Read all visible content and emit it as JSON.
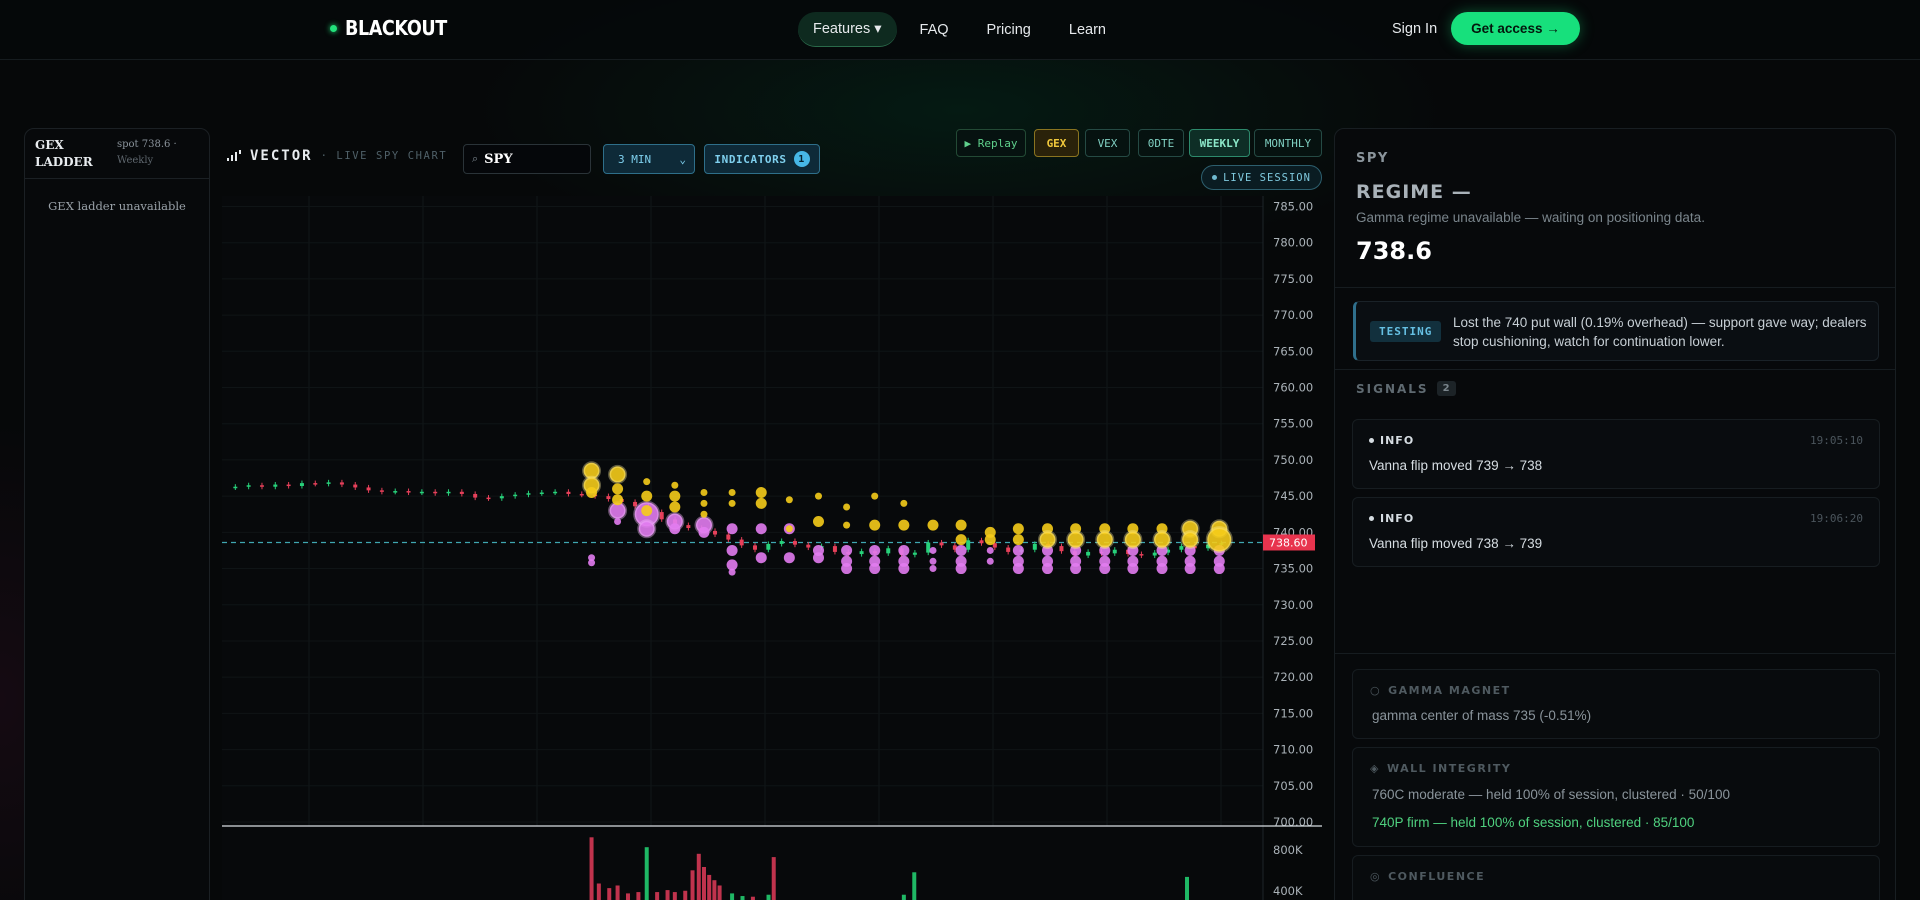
{
  "nav": {
    "brand": "BLACKOUT",
    "links": [
      {
        "label": "Features ▾",
        "active": true
      },
      {
        "label": "FAQ",
        "active": false
      },
      {
        "label": "Pricing",
        "active": false
      },
      {
        "label": "Learn",
        "active": false
      }
    ],
    "signin": "Sign In",
    "cta": "Get access →"
  },
  "gex_ladder": {
    "title": "GEX LADDER",
    "spot": "spot 738.6 ·",
    "period": "Weekly",
    "empty": "GEX ladder unavailable"
  },
  "toolbar": {
    "brand": "VECTOR",
    "subtitle": "· LIVE SPY CHART",
    "ticker": "SPY",
    "interval": "3 MIN",
    "indicators_label": "INDICATORS",
    "indicators_count": "1",
    "replay": "▶ Replay",
    "chips": [
      "GEX",
      "VEX",
      "0DTE",
      "WEEKLY",
      "MONTHLY"
    ],
    "live_session": "LIVE SESSION"
  },
  "chart_data": {
    "type": "candlestick",
    "symbol": "SPY",
    "interval": "3 MIN",
    "y_ticks": [
      785,
      780,
      775,
      770,
      765,
      760,
      755,
      750,
      745,
      740,
      735,
      730,
      725,
      720,
      715,
      710,
      705,
      700
    ],
    "ylim": [
      700,
      787
    ],
    "current_price": 738.6,
    "current_price_label": "738.60",
    "volume_ticks": [
      "800K",
      "400K"
    ],
    "price_path": [
      746.2,
      746.3,
      746.5,
      746.3,
      746.6,
      746.4,
      746.8,
      746.7,
      746.9,
      746.6,
      746.2,
      745.8,
      745.6,
      745.7,
      745.5,
      745.6,
      745.4,
      745.6,
      745.3,
      744.8,
      744.7,
      745.0,
      745.2,
      745.4,
      745.5,
      745.6,
      745.3,
      745.2,
      745.0,
      744.6,
      744.2,
      743.6,
      742.8,
      741.8,
      741.0,
      740.6,
      740.2,
      739.7,
      739.0,
      738.2,
      737.6,
      738.4,
      738.8,
      738.3,
      737.9,
      738.1,
      737.3,
      737.0,
      737.4,
      737.1,
      737.8,
      736.9,
      737.2,
      738.6,
      738.2,
      737.6,
      738.9,
      738.5,
      737.9,
      737.3,
      737.6,
      738.4,
      738.1,
      737.4,
      736.8,
      737.3,
      737.1,
      737.6,
      737.0,
      736.8,
      737.2,
      737.6,
      738.1,
      737.8,
      738.3,
      738.5
    ],
    "gex_bubbles": [
      {
        "t": 0.355,
        "strike": 748.5,
        "size": 3
      },
      {
        "t": 0.355,
        "strike": 746.5,
        "size": 3
      },
      {
        "t": 0.355,
        "strike": 745.5,
        "size": 2
      },
      {
        "t": 0.38,
        "strike": 748,
        "size": 3
      },
      {
        "t": 0.38,
        "strike": 746,
        "size": 2
      },
      {
        "t": 0.38,
        "strike": 744.5,
        "size": 2
      },
      {
        "t": 0.408,
        "strike": 747,
        "size": 1
      },
      {
        "t": 0.408,
        "strike": 745,
        "size": 2
      },
      {
        "t": 0.408,
        "strike": 743,
        "size": 2
      },
      {
        "t": 0.435,
        "strike": 746.5,
        "size": 1
      },
      {
        "t": 0.435,
        "strike": 745,
        "size": 2
      },
      {
        "t": 0.435,
        "strike": 743.5,
        "size": 2
      },
      {
        "t": 0.463,
        "strike": 745.5,
        "size": 1
      },
      {
        "t": 0.463,
        "strike": 744,
        "size": 1
      },
      {
        "t": 0.463,
        "strike": 742.5,
        "size": 1
      },
      {
        "t": 0.49,
        "strike": 745.5,
        "size": 1
      },
      {
        "t": 0.49,
        "strike": 744,
        "size": 1
      },
      {
        "t": 0.518,
        "strike": 745.5,
        "size": 2
      },
      {
        "t": 0.518,
        "strike": 744,
        "size": 2
      },
      {
        "t": 0.545,
        "strike": 744.5,
        "size": 1
      },
      {
        "t": 0.545,
        "strike": 740.5,
        "size": 1
      },
      {
        "t": 0.573,
        "strike": 745,
        "size": 1
      },
      {
        "t": 0.573,
        "strike": 741.5,
        "size": 2
      },
      {
        "t": 0.6,
        "strike": 743.5,
        "size": 1
      },
      {
        "t": 0.6,
        "strike": 741,
        "size": 1
      },
      {
        "t": 0.627,
        "strike": 745,
        "size": 1
      },
      {
        "t": 0.627,
        "strike": 741,
        "size": 2
      },
      {
        "t": 0.655,
        "strike": 744,
        "size": 1
      },
      {
        "t": 0.655,
        "strike": 741,
        "size": 2
      },
      {
        "t": 0.683,
        "strike": 741,
        "size": 2
      },
      {
        "t": 0.71,
        "strike": 741,
        "size": 2
      },
      {
        "t": 0.71,
        "strike": 739,
        "size": 2
      },
      {
        "t": 0.738,
        "strike": 740,
        "size": 2
      },
      {
        "t": 0.738,
        "strike": 739,
        "size": 2
      },
      {
        "t": 0.765,
        "strike": 740.5,
        "size": 2
      },
      {
        "t": 0.765,
        "strike": 739,
        "size": 2
      },
      {
        "t": 0.793,
        "strike": 740.5,
        "size": 2
      },
      {
        "t": 0.793,
        "strike": 739,
        "size": 3
      },
      {
        "t": 0.82,
        "strike": 740.5,
        "size": 2
      },
      {
        "t": 0.82,
        "strike": 739,
        "size": 3
      },
      {
        "t": 0.848,
        "strike": 740.5,
        "size": 2
      },
      {
        "t": 0.848,
        "strike": 739,
        "size": 3
      },
      {
        "t": 0.875,
        "strike": 740.5,
        "size": 2
      },
      {
        "t": 0.875,
        "strike": 739,
        "size": 3
      },
      {
        "t": 0.903,
        "strike": 740.5,
        "size": 2
      },
      {
        "t": 0.903,
        "strike": 739,
        "size": 3
      },
      {
        "t": 0.93,
        "strike": 740.5,
        "size": 3
      },
      {
        "t": 0.93,
        "strike": 739,
        "size": 3
      },
      {
        "t": 0.958,
        "strike": 740.5,
        "size": 3
      },
      {
        "t": 0.958,
        "strike": 739,
        "size": 4
      }
    ],
    "vex_bubbles": [
      {
        "t": 0.355,
        "strike": 736.5,
        "size": 1
      },
      {
        "t": 0.355,
        "strike": 735.8,
        "size": 1
      },
      {
        "t": 0.38,
        "strike": 743,
        "size": 3
      },
      {
        "t": 0.38,
        "strike": 741.5,
        "size": 1
      },
      {
        "t": 0.408,
        "strike": 742.5,
        "size": 4
      },
      {
        "t": 0.408,
        "strike": 740.5,
        "size": 3
      },
      {
        "t": 0.435,
        "strike": 741.5,
        "size": 3
      },
      {
        "t": 0.435,
        "strike": 740.5,
        "size": 2
      },
      {
        "t": 0.463,
        "strike": 741,
        "size": 3
      },
      {
        "t": 0.463,
        "strike": 740,
        "size": 2
      },
      {
        "t": 0.49,
        "strike": 740.5,
        "size": 2
      },
      {
        "t": 0.49,
        "strike": 737.5,
        "size": 2
      },
      {
        "t": 0.49,
        "strike": 735.5,
        "size": 2
      },
      {
        "t": 0.49,
        "strike": 734.5,
        "size": 1
      },
      {
        "t": 0.518,
        "strike": 740.5,
        "size": 2
      },
      {
        "t": 0.518,
        "strike": 736.5,
        "size": 2
      },
      {
        "t": 0.545,
        "strike": 740.5,
        "size": 2
      },
      {
        "t": 0.545,
        "strike": 736.5,
        "size": 2
      },
      {
        "t": 0.573,
        "strike": 737.5,
        "size": 2
      },
      {
        "t": 0.573,
        "strike": 736.5,
        "size": 2
      },
      {
        "t": 0.6,
        "strike": 737.5,
        "size": 2
      },
      {
        "t": 0.6,
        "strike": 736,
        "size": 2
      },
      {
        "t": 0.6,
        "strike": 735,
        "size": 2
      },
      {
        "t": 0.627,
        "strike": 737.5,
        "size": 2
      },
      {
        "t": 0.627,
        "strike": 736,
        "size": 2
      },
      {
        "t": 0.627,
        "strike": 735,
        "size": 2
      },
      {
        "t": 0.655,
        "strike": 737.5,
        "size": 2
      },
      {
        "t": 0.655,
        "strike": 736,
        "size": 2
      },
      {
        "t": 0.655,
        "strike": 735,
        "size": 2
      },
      {
        "t": 0.683,
        "strike": 737.5,
        "size": 1
      },
      {
        "t": 0.683,
        "strike": 736,
        "size": 1
      },
      {
        "t": 0.683,
        "strike": 735,
        "size": 1
      },
      {
        "t": 0.71,
        "strike": 737.5,
        "size": 2
      },
      {
        "t": 0.71,
        "strike": 736,
        "size": 2
      },
      {
        "t": 0.71,
        "strike": 735,
        "size": 2
      },
      {
        "t": 0.738,
        "strike": 737.5,
        "size": 1
      },
      {
        "t": 0.738,
        "strike": 736,
        "size": 1
      },
      {
        "t": 0.765,
        "strike": 737.5,
        "size": 2
      },
      {
        "t": 0.765,
        "strike": 736,
        "size": 2
      },
      {
        "t": 0.765,
        "strike": 735,
        "size": 2
      },
      {
        "t": 0.793,
        "strike": 737.5,
        "size": 2
      },
      {
        "t": 0.793,
        "strike": 736,
        "size": 2
      },
      {
        "t": 0.793,
        "strike": 735,
        "size": 2
      },
      {
        "t": 0.82,
        "strike": 737.5,
        "size": 2
      },
      {
        "t": 0.82,
        "strike": 736,
        "size": 2
      },
      {
        "t": 0.82,
        "strike": 735,
        "size": 2
      },
      {
        "t": 0.848,
        "strike": 737.5,
        "size": 2
      },
      {
        "t": 0.848,
        "strike": 736,
        "size": 2
      },
      {
        "t": 0.848,
        "strike": 735,
        "size": 2
      },
      {
        "t": 0.875,
        "strike": 737.5,
        "size": 2
      },
      {
        "t": 0.875,
        "strike": 736,
        "size": 2
      },
      {
        "t": 0.875,
        "strike": 735,
        "size": 2
      },
      {
        "t": 0.903,
        "strike": 737.5,
        "size": 2
      },
      {
        "t": 0.903,
        "strike": 736,
        "size": 2
      },
      {
        "t": 0.903,
        "strike": 735,
        "size": 2
      },
      {
        "t": 0.93,
        "strike": 737.5,
        "size": 2
      },
      {
        "t": 0.93,
        "strike": 736,
        "size": 2
      },
      {
        "t": 0.93,
        "strike": 735,
        "size": 2
      },
      {
        "t": 0.958,
        "strike": 737.5,
        "size": 2
      },
      {
        "t": 0.958,
        "strike": 736,
        "size": 2
      },
      {
        "t": 0.958,
        "strike": 735,
        "size": 2
      }
    ],
    "volume_bars": [
      {
        "t": 0.355,
        "v": 0.95,
        "up": false
      },
      {
        "t": 0.362,
        "v": 0.25,
        "up": false
      },
      {
        "t": 0.372,
        "v": 0.18,
        "up": false
      },
      {
        "t": 0.38,
        "v": 0.22,
        "up": false
      },
      {
        "t": 0.39,
        "v": 0.1,
        "up": false
      },
      {
        "t": 0.4,
        "v": 0.12,
        "up": false
      },
      {
        "t": 0.408,
        "v": 0.8,
        "up": true
      },
      {
        "t": 0.418,
        "v": 0.12,
        "up": false
      },
      {
        "t": 0.428,
        "v": 0.15,
        "up": false
      },
      {
        "t": 0.435,
        "v": 0.12,
        "up": false
      },
      {
        "t": 0.445,
        "v": 0.14,
        "up": false
      },
      {
        "t": 0.452,
        "v": 0.45,
        "up": false
      },
      {
        "t": 0.458,
        "v": 0.7,
        "up": false
      },
      {
        "t": 0.463,
        "v": 0.5,
        "up": false
      },
      {
        "t": 0.468,
        "v": 0.38,
        "up": false
      },
      {
        "t": 0.473,
        "v": 0.3,
        "up": false
      },
      {
        "t": 0.478,
        "v": 0.22,
        "up": false
      },
      {
        "t": 0.49,
        "v": 0.1,
        "up": true
      },
      {
        "t": 0.5,
        "v": 0.06,
        "up": true
      },
      {
        "t": 0.51,
        "v": 0.05,
        "up": false
      },
      {
        "t": 0.525,
        "v": 0.08,
        "up": true
      },
      {
        "t": 0.53,
        "v": 0.65,
        "up": false
      },
      {
        "t": 0.655,
        "v": 0.08,
        "up": true
      },
      {
        "t": 0.665,
        "v": 0.42,
        "up": true
      },
      {
        "t": 0.927,
        "v": 0.35,
        "up": true
      }
    ]
  },
  "right": {
    "symbol": "SPY",
    "regime": "REGIME —",
    "regime_sub": "Gamma regime unavailable — waiting on positioning data.",
    "spot": "738.6",
    "testing_badge": "TESTING",
    "testing_text": "Lost the 740 put wall (0.19% overhead) — support gave way; dealers stop cushioning, watch for continuation lower.",
    "signals_label": "SIGNALS",
    "signals_count": "2",
    "signals": [
      {
        "level": "INFO",
        "time": "19:05:10",
        "message": "Vanna flip moved 739 → 738"
      },
      {
        "level": "INFO",
        "time": "19:06:20",
        "message": "Vanna flip moved 738 → 739"
      }
    ],
    "gamma_magnet": {
      "title": "GAMMA MAGNET",
      "line": "gamma center of mass 735 (-0.51%)"
    },
    "wall_integrity": {
      "title": "WALL INTEGRITY",
      "line1": "760C moderate — held 100% of session, clustered · 50/100",
      "line2": "740P firm — held 100% of session, clustered · 85/100"
    },
    "confluence": {
      "title": "CONFLUENCE"
    }
  },
  "colors": {
    "accent_green": "#17e07c",
    "gex": "#f5cc1a",
    "vex": "#e27cf0",
    "price_tag": "#e8344e",
    "spot_line": "#3fa7b0"
  }
}
